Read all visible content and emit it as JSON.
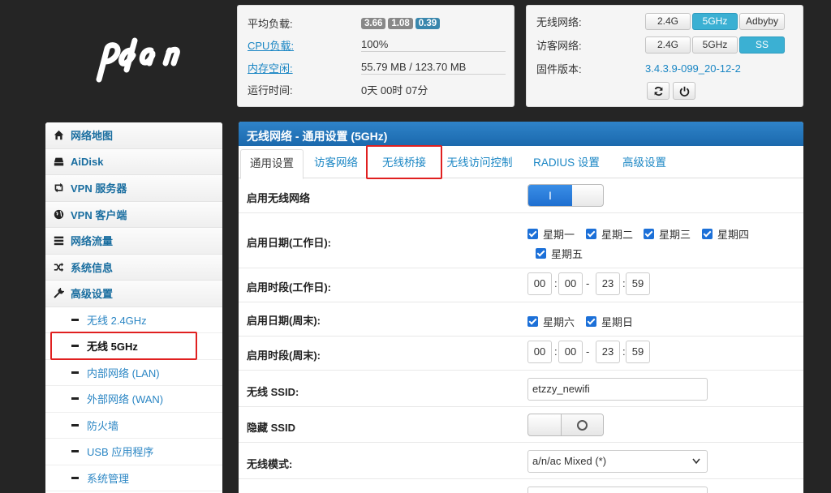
{
  "logo_text": "pdcn",
  "stats": {
    "load_label": "平均负载:",
    "load_values": [
      "3.66",
      "1.08",
      "0.39"
    ],
    "cpu_label": "CPU负载:",
    "cpu_value": "100%",
    "mem_label": "内存空闲:",
    "mem_value": "55.79 MB / 123.70 MB",
    "uptime_label": "运行时间:",
    "uptime_value": "0天 00时 07分"
  },
  "wifi_panel": {
    "wireless_label": "无线网络:",
    "wireless_buttons": [
      "2.4G",
      "5GHz",
      "Adbyby"
    ],
    "guest_label": "访客网络:",
    "guest_buttons": [
      "2.4G",
      "5GHz",
      "SS"
    ],
    "firmware_label": "固件版本:",
    "firmware_value": "3.4.3.9-099_20-12-2"
  },
  "sidebar": {
    "items": [
      {
        "label": "网络地图",
        "icon": "home-icon"
      },
      {
        "label": "AiDisk",
        "icon": "hdd-icon"
      },
      {
        "label": "VPN 服务器",
        "icon": "retweet-icon"
      },
      {
        "label": "VPN 客户端",
        "icon": "globe-icon"
      },
      {
        "label": "网络流量",
        "icon": "tasks-icon"
      },
      {
        "label": "系统信息",
        "icon": "random-icon"
      },
      {
        "label": "高级设置",
        "icon": "wrench-icon"
      }
    ],
    "sub_items": [
      "无线 2.4GHz",
      "无线 5GHz",
      "内部网络 (LAN)",
      "外部网络 (WAN)",
      "防火墙",
      "USB 应用程序",
      "系统管理"
    ]
  },
  "main": {
    "title": "无线网络 - 通用设置 (5GHz)",
    "tabs": [
      "通用设置",
      "访客网络",
      "无线桥接",
      "无线访问控制",
      "RADIUS 设置",
      "高级设置"
    ],
    "enable_label": "启用无线网络",
    "enable_toggle": "I",
    "weekday_label": "启用日期(工作日):",
    "weekdays": [
      "星期一",
      "星期二",
      "星期三",
      "星期四",
      "星期五"
    ],
    "weekday_time_label": "启用时段(工作日):",
    "weekday_time": [
      "00",
      "00",
      "23",
      "59"
    ],
    "weekend_label": "启用日期(周末):",
    "weekend_days": [
      "星期六",
      "星期日"
    ],
    "weekend_time_label": "启用时段(周末):",
    "weekend_time": [
      "00",
      "00",
      "23",
      "59"
    ],
    "ssid_label": "无线 SSID:",
    "ssid_value": "etzzy_newifi",
    "hide_ssid_label": "隐藏 SSID",
    "mode_label": "无线模式:",
    "mode_value": "a/n/ac Mixed (*)"
  },
  "colors": {
    "accent": "#1a86c4",
    "header": "#2373b8",
    "active_button": "#3bb0d3",
    "highlight": "#e02020"
  }
}
